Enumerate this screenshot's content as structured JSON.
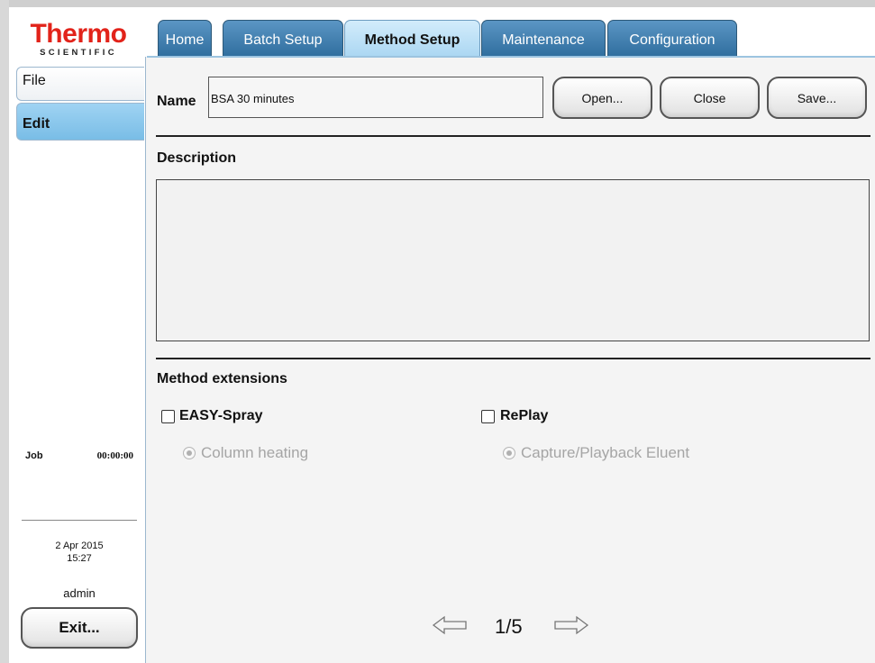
{
  "logo": {
    "brand": "Thermo",
    "sub": "SCIENTIFIC"
  },
  "tabs": [
    {
      "label": "Home"
    },
    {
      "label": "Batch Setup"
    },
    {
      "label": "Method Setup"
    },
    {
      "label": "Maintenance"
    },
    {
      "label": "Configuration"
    }
  ],
  "sidebar": {
    "items": [
      {
        "label": "File"
      },
      {
        "label": "Edit"
      }
    ],
    "job_label": "Job",
    "job_time": "00:00:00",
    "date": "2 Apr 2015",
    "time": "15:27",
    "user": "admin",
    "exit_label": "Exit..."
  },
  "name": {
    "label": "Name",
    "value": "BSA 30 minutes",
    "open_label": "Open...",
    "close_label": "Close",
    "save_label": "Save..."
  },
  "description": {
    "label": "Description",
    "value": ""
  },
  "extensions": {
    "label": "Method extensions",
    "easy_spray": {
      "label": "EASY-Spray",
      "checked": false,
      "option": "Column heating"
    },
    "replay": {
      "label": "RePlay",
      "checked": false,
      "option": "Capture/Playback Eluent"
    }
  },
  "pager": {
    "current": "1/5"
  },
  "colors": {
    "brand_red": "#e2231a",
    "tab_blue": "#3f80b2",
    "tab_active": "#bfe2f7",
    "edit_highlight": "#8cc8ec"
  },
  "icons": {
    "checkbox": "checkbox-unchecked-icon",
    "radio": "radio-selected-disabled-icon",
    "prev": "arrow-left-icon",
    "next": "arrow-right-icon"
  }
}
